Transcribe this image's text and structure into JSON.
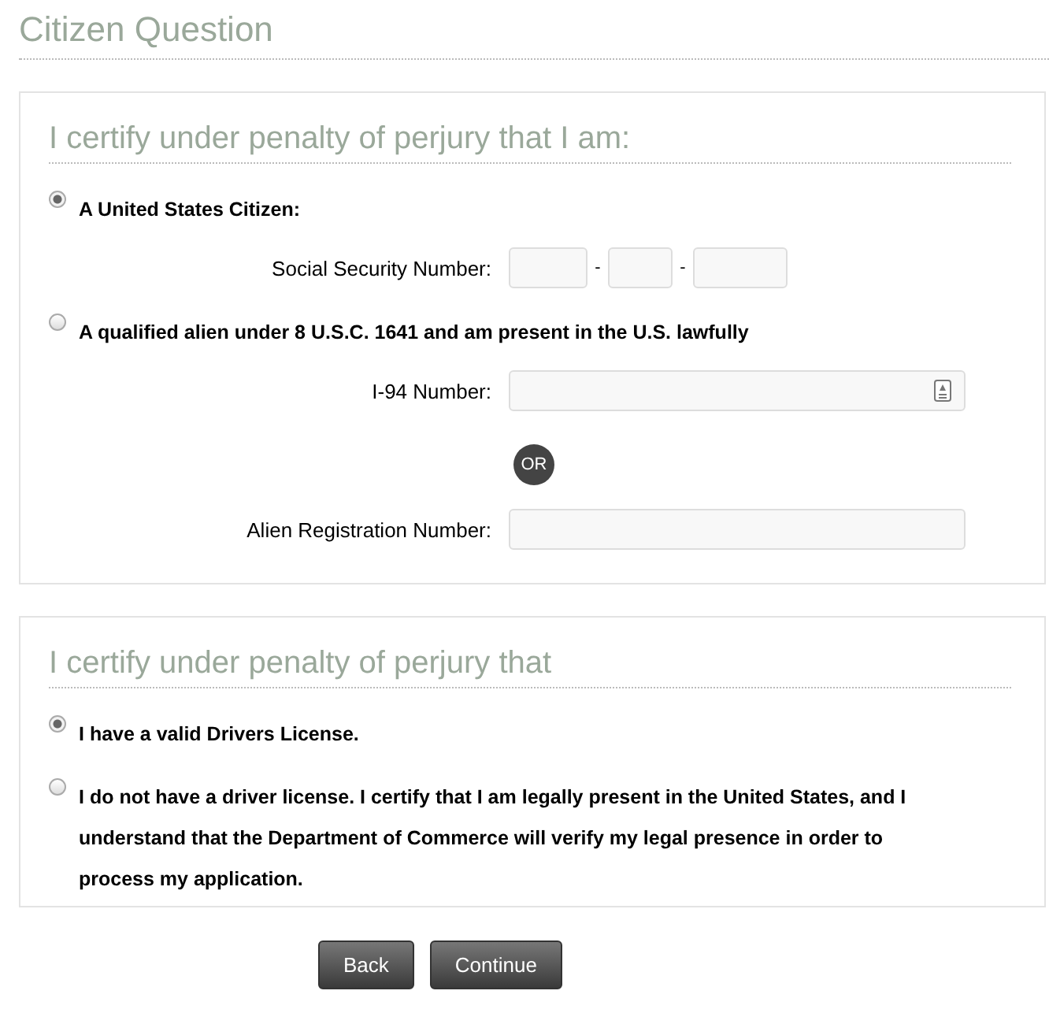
{
  "title": "Citizen Question",
  "sections": [
    {
      "heading": "I certify under penalty of perjury that I am:",
      "options": [
        {
          "label": "A United States Citizen:",
          "selected": true,
          "fields": [
            {
              "kind": "ssn",
              "label": "Social Security Number:",
              "separators": [
                "-",
                "-"
              ]
            }
          ]
        },
        {
          "label": "A qualified alien under 8 U.S.C. 1641 and am present in the U.S. lawfully",
          "selected": false,
          "fields": [
            {
              "kind": "text",
              "label": "I-94 Number:",
              "has_icon": true
            },
            {
              "kind": "divider",
              "text": "OR"
            },
            {
              "kind": "text",
              "label": "Alien Registration Number:",
              "has_icon": false
            }
          ]
        }
      ]
    },
    {
      "heading": "I certify under penalty of perjury that",
      "options": [
        {
          "label": "I have a valid Drivers License.",
          "selected": true
        },
        {
          "label": "I do not have a driver license. I certify that I am legally present in the United States, and I understand that the Department of Commerce will verify my legal presence in order to process my application.",
          "selected": false
        }
      ]
    }
  ],
  "buttons": [
    "Back",
    "Continue"
  ]
}
